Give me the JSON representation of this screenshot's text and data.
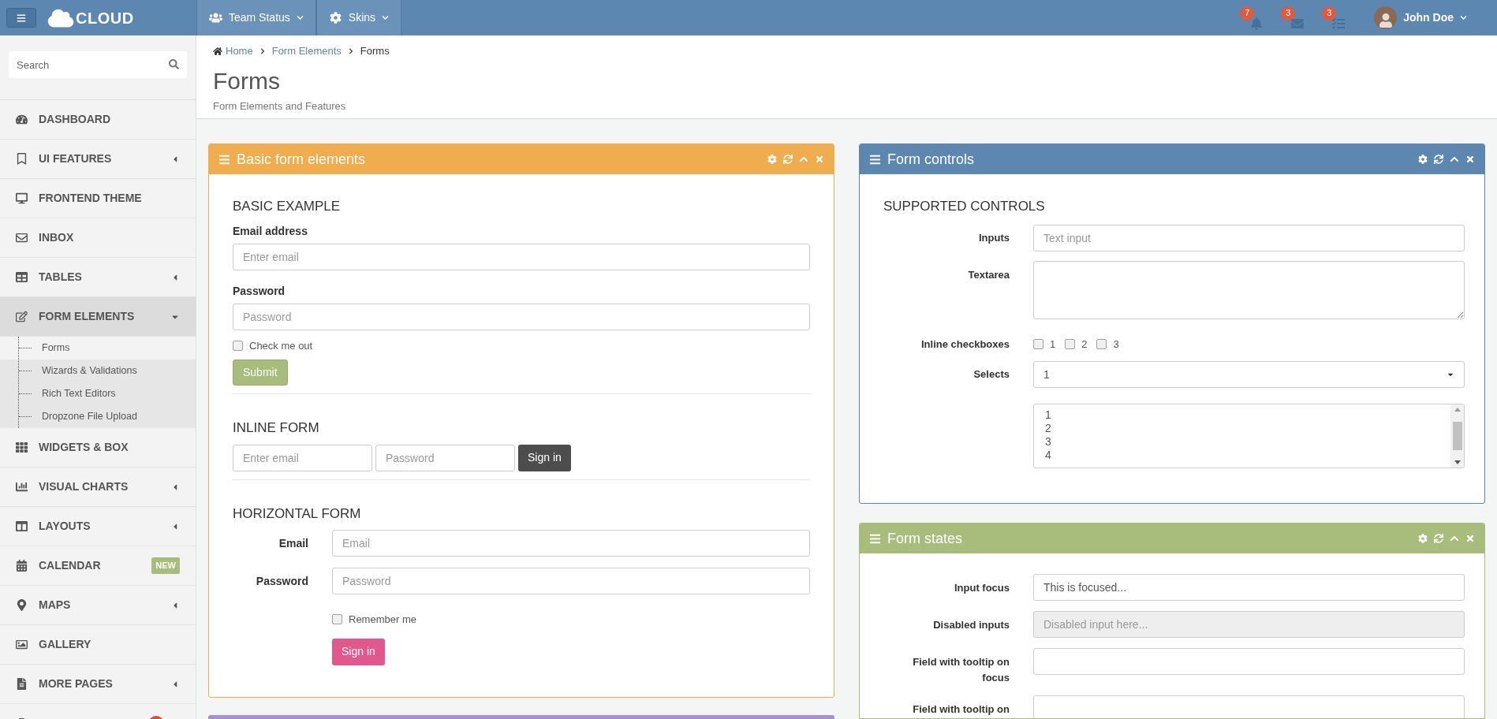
{
  "topbar": {
    "logo": "CLOUD",
    "menus": [
      {
        "kind": "team",
        "label": "Team Status"
      },
      {
        "kind": "skins",
        "label": "Skins"
      }
    ],
    "notifications": [
      {
        "kind": "bell",
        "count": "7"
      },
      {
        "kind": "mail",
        "count": "3"
      },
      {
        "kind": "tasks",
        "count": "3"
      }
    ],
    "user": {
      "name": "John Doe"
    }
  },
  "sidebar": {
    "search": {
      "placeholder": "Search"
    },
    "items": [
      {
        "label": "DASHBOARD",
        "submenu": false,
        "expanded": false
      },
      {
        "label": "UI FEATURES",
        "submenu": true,
        "expanded": false
      },
      {
        "label": "FRONTEND THEME",
        "submenu": false,
        "expanded": false
      },
      {
        "label": "INBOX",
        "submenu": false,
        "expanded": false
      },
      {
        "label": "TABLES",
        "submenu": true,
        "expanded": false
      },
      {
        "label": "FORM ELEMENTS",
        "submenu": true,
        "expanded": true,
        "children": [
          {
            "label": "Forms",
            "selected": true
          },
          {
            "label": "Wizards & Validations",
            "selected": false
          },
          {
            "label": "Rich Text Editors",
            "selected": false
          },
          {
            "label": "Dropzone File Upload",
            "selected": false
          }
        ]
      },
      {
        "label": "WIDGETS & BOX",
        "submenu": false,
        "expanded": false
      },
      {
        "label": "VISUAL CHARTS",
        "submenu": true,
        "expanded": false
      },
      {
        "label": "LAYOUTS",
        "submenu": true,
        "expanded": false
      },
      {
        "label": "CALENDAR",
        "submenu": false,
        "expanded": false,
        "badge": "NEW"
      },
      {
        "label": "MAPS",
        "submenu": true,
        "expanded": false
      },
      {
        "label": "GALLERY",
        "submenu": false,
        "expanded": false
      },
      {
        "label": "MORE PAGES",
        "submenu": true,
        "expanded": false
      },
      {
        "submenu": false,
        "expanded": false,
        "dot": true
      }
    ]
  },
  "breadcrumb": [
    {
      "kind": "home",
      "label": "Home"
    },
    {
      "kind": "link",
      "label": "Form Elements"
    },
    {
      "kind": "current",
      "label": "Forms"
    }
  ],
  "page": {
    "title": "Forms",
    "subtitle": "Form Elements and Features"
  },
  "basic_panel": {
    "title": "Basic form elements",
    "color": "#efad4e",
    "basic_example": {
      "heading": "BASIC EXAMPLE",
      "email_label": "Email address",
      "email_placeholder": "Enter email",
      "password_label": "Password",
      "password_placeholder": "Password",
      "check_label": "Check me out",
      "checked": false,
      "submit": "Submit"
    },
    "inline_form": {
      "heading": "INLINE FORM",
      "email_placeholder": "Enter email",
      "password_placeholder": "Password",
      "button": "Sign in"
    },
    "horizontal_form": {
      "heading": "HORIZONTAL FORM",
      "email_label": "Email",
      "email_placeholder": "Email",
      "password_label": "Password",
      "password_placeholder": "Password",
      "check_label": "Remember me",
      "checked": false,
      "button": "Sign in"
    }
  },
  "next_panel": {
    "color": "#a491d3"
  },
  "controls_panel": {
    "title": "Form controls",
    "color": "#5b87b0",
    "heading": "SUPPORTED CONTROLS",
    "inputs_label": "Inputs",
    "inputs_placeholder": "Text input",
    "textarea_label": "Textarea",
    "checkboxes_label": "Inline checkboxes",
    "checkboxes": [
      {
        "label": "1",
        "checked": false
      },
      {
        "label": "2",
        "checked": false
      },
      {
        "label": "3",
        "checked": false
      }
    ],
    "selects_label": "Selects",
    "select_value": "1",
    "list_options": [
      "1",
      "2",
      "3",
      "4"
    ]
  },
  "states_panel": {
    "title": "Form states",
    "color": "#a8bc7b",
    "rows": [
      {
        "kind": "focused",
        "label": "Input focus",
        "value": "This is focused..."
      },
      {
        "kind": "disabled",
        "label": "Disabled inputs",
        "placeholder": "Disabled input here..."
      },
      {
        "kind": "plain",
        "label": "Field with tooltip on focus"
      },
      {
        "kind": "plain",
        "label": "Field with tooltip on"
      }
    ]
  }
}
